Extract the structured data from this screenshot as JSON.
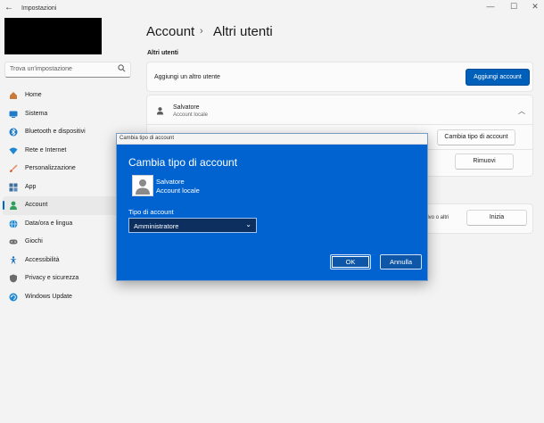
{
  "window": {
    "title": "Impostazioni",
    "controls": {
      "minimize": "—",
      "maximize": "☐",
      "close": "✕"
    }
  },
  "search": {
    "placeholder": "Trova un'impostazione"
  },
  "sidebar": {
    "items": [
      {
        "label": "Home",
        "icon": "home-icon",
        "color": "#c87a3a"
      },
      {
        "label": "Sistema",
        "icon": "system-icon",
        "color": "#1f7bc8"
      },
      {
        "label": "Bluetooth e dispositivi",
        "icon": "bluetooth-icon",
        "color": "#1f7bc8"
      },
      {
        "label": "Rete e Internet",
        "icon": "wifi-icon",
        "color": "#1f88d2"
      },
      {
        "label": "Personalizzazione",
        "icon": "brush-icon",
        "color": "#e6875a"
      },
      {
        "label": "App",
        "icon": "apps-icon",
        "color": "#3b6e9a"
      },
      {
        "label": "Account",
        "icon": "account-icon",
        "color": "#2ea05a",
        "selected": true
      },
      {
        "label": "Data/ora e lingua",
        "icon": "globe-icon",
        "color": "#1f88d2"
      },
      {
        "label": "Giochi",
        "icon": "gamepad-icon",
        "color": "#6b6b6b"
      },
      {
        "label": "Accessibilità",
        "icon": "accessibility-icon",
        "color": "#1f6fc0"
      },
      {
        "label": "Privacy e sicurezza",
        "icon": "shield-icon",
        "color": "#6b6b6b"
      },
      {
        "label": "Windows Update",
        "icon": "update-icon",
        "color": "#1f88d2"
      }
    ]
  },
  "main": {
    "breadcrumb": {
      "parent": "Account",
      "separator": "›",
      "current": "Altri utenti"
    },
    "section_label": "Altri utenti",
    "add_user": {
      "label": "Aggiungi un altro utente",
      "button": "Aggiungi account"
    },
    "user": {
      "name": "Salvatore",
      "type": "Account locale",
      "change_button": "Cambia tipo di account",
      "remove_button": "Rimuovi"
    },
    "kiosk": {
      "text": "ttivo o altri",
      "button": "Inizia"
    }
  },
  "dialog": {
    "window_title": "Cambia tipo di account",
    "heading": "Cambia tipo di account",
    "user_name": "Salvatore",
    "user_type": "Account locale",
    "field_label": "Tipo di account",
    "selected_value": "Amministratore",
    "ok": "OK",
    "cancel": "Annulla"
  },
  "colors": {
    "accent": "#005fb8",
    "dialog_bg": "#0063cf"
  }
}
